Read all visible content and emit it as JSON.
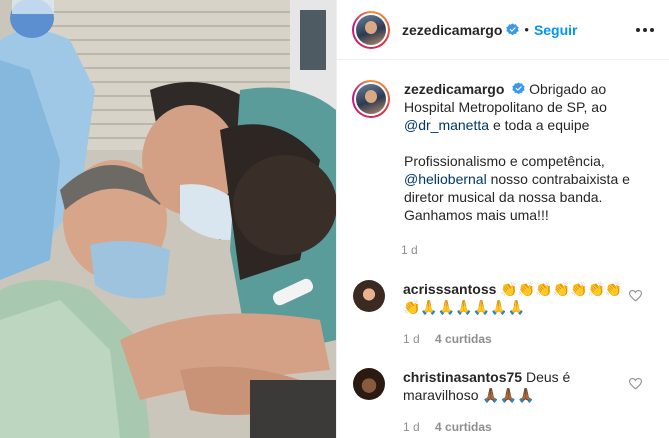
{
  "post": {
    "username": "zezedicamargo",
    "separator": "•",
    "follow_label": "Seguir",
    "caption": {
      "username": "zezedicamargo",
      "text_1": "Obrigado ao Hospital Metropolitano de SP, ao",
      "mention_1": "@dr_manetta",
      "text_2": "e toda a equipe",
      "text_3": "Profissionalismo e competência,",
      "mention_2": "@heliobernal",
      "text_4": "nosso contrabaixista e diretor musical da nossa banda. Ganhamos mais uma!!!",
      "time": "1 d"
    },
    "icons": {
      "verified": "verified-badge-icon",
      "more": "more-options-icon",
      "like": "heart-icon"
    },
    "accent_color": "#0095f6"
  },
  "comments": [
    {
      "username": "acrisssantoss",
      "text": "👏👏👏👏👏👏👏👏🙏🙏🙏🙏🙏🙏",
      "time": "1 d",
      "likes": "4 curtidas"
    },
    {
      "username": "christinasantos75",
      "text": "Deus é maravilhoso 🙏🏾🙏🏾🙏🏾",
      "time": "1 d",
      "likes": "4 curtidas"
    }
  ]
}
